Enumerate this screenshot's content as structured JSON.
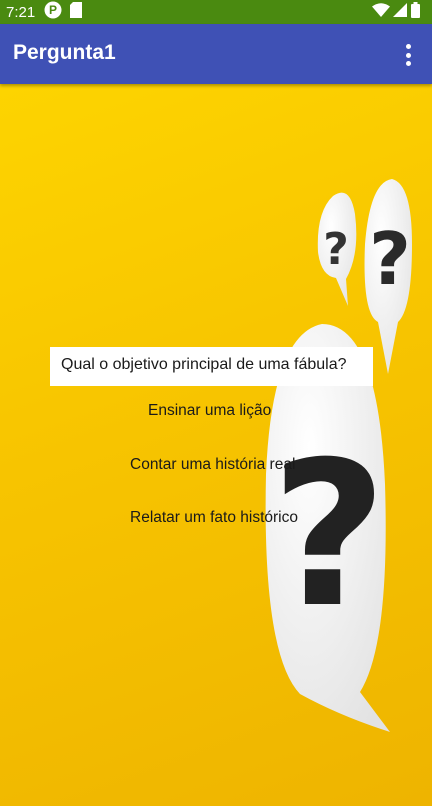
{
  "status_bar": {
    "time": "7:21",
    "icons": [
      "app-notification-icon",
      "sd-card-icon",
      "wifi-icon",
      "cellular-signal-icon",
      "battery-icon"
    ]
  },
  "app_bar": {
    "title": "Pergunta1",
    "menu_icon": "more-vert-icon"
  },
  "quiz": {
    "question": "Qual o objetivo principal de uma fábula?",
    "answers": [
      "Ensinar uma lição",
      "Contar uma história real",
      "Relatar um fato histórico"
    ]
  },
  "background": {
    "image": "question-marks-illustration",
    "colors": {
      "yellow_light": "#fdd400",
      "yellow_dark": "#eeb400",
      "app_bar": "#3f51b5",
      "status_bar": "#4a8a10"
    }
  }
}
